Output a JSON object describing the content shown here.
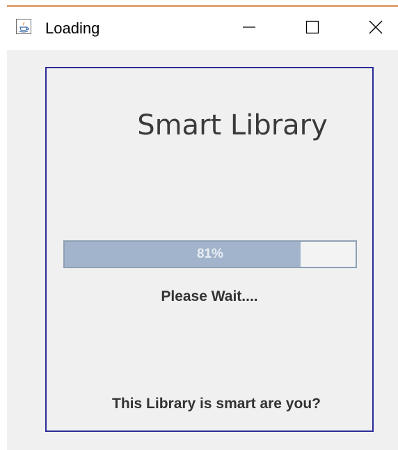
{
  "window": {
    "title": "Loading",
    "icon": "java-icon",
    "controls": {
      "minimize": "minimize-icon",
      "maximize": "maximize-icon",
      "close": "close-icon"
    }
  },
  "content": {
    "app_title": "Smart Library",
    "progress": {
      "value": 81,
      "label": "81%"
    },
    "status_text": "Please Wait....",
    "tagline": "This Library is smart are you?"
  },
  "colors": {
    "panel_border": "#2b2b9a",
    "progress_fill": "#a2b4cb",
    "progress_border": "#8ea0b3",
    "window_background": "#f0f0f0",
    "title_bar": "#ffffff"
  }
}
